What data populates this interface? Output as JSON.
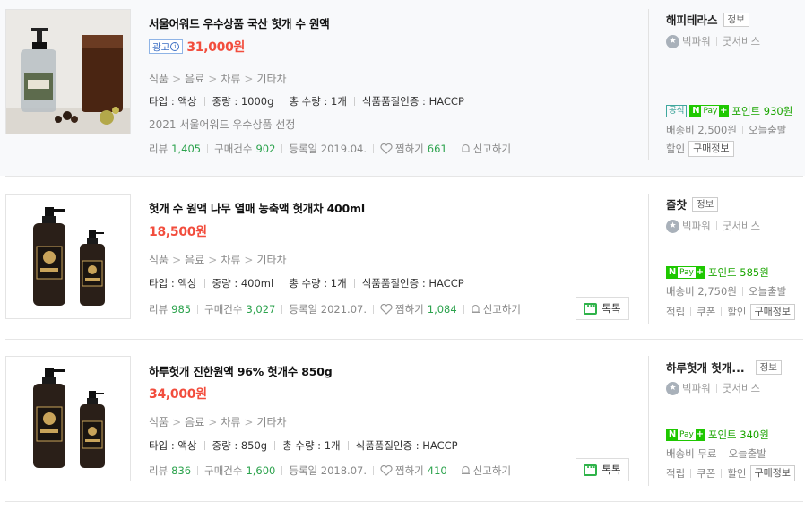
{
  "products": [
    {
      "title": "서울어워드 우수상품 국산 헛개 수 원액",
      "ad": true,
      "ad_label": "광고",
      "price": "31,000원",
      "category": [
        "식품",
        "음료",
        "차류",
        "기타차"
      ],
      "spec": [
        "타입 : 액상",
        "중량 : 1000g",
        "총 수량 : 1개",
        "식품품질인증 : HACCP"
      ],
      "note": "2021 서울어워드 우수상품 선정",
      "review_label": "리뷰",
      "review_count": "1,405",
      "purchase_label": "구매건수",
      "purchase_count": "902",
      "reg_label": "등록일 2019.04.",
      "wish_label": "찜하기",
      "wish_count": "661",
      "report_label": "신고하기",
      "talk_label": "",
      "mall": {
        "name": "해피테라스",
        "info_label": "정보",
        "grade": "빅파워",
        "service": "굿서비스",
        "official_label": "공식",
        "npay_label": "Pay",
        "point": "포인트 930원",
        "shipping": "배송비 2,500원",
        "dispatch": "오늘출발",
        "benefits": [
          "할인"
        ],
        "purchase_info": "구매정보"
      }
    },
    {
      "title": "헛개 수 원액 나무 열매 농축액 헛개차 400ml",
      "ad": false,
      "price": "18,500원",
      "category": [
        "식품",
        "음료",
        "차류",
        "기타차"
      ],
      "spec": [
        "타입 : 액상",
        "중량 : 400ml",
        "총 수량 : 1개",
        "식품품질인증 : HACCP"
      ],
      "note": "",
      "review_label": "리뷰",
      "review_count": "985",
      "purchase_label": "구매건수",
      "purchase_count": "3,027",
      "reg_label": "등록일 2021.07.",
      "wish_label": "찜하기",
      "wish_count": "1,084",
      "report_label": "신고하기",
      "talk_label": "톡톡",
      "mall": {
        "name": "즐찻",
        "info_label": "정보",
        "grade": "빅파워",
        "service": "굿서비스",
        "npay_label": "Pay",
        "point": "포인트 585원",
        "shipping": "배송비 2,750원",
        "dispatch": "오늘출발",
        "benefits": [
          "적립",
          "쿠폰",
          "할인"
        ],
        "purchase_info": "구매정보"
      }
    },
    {
      "title": "하루헛개 진한원액 96% 헛개수 850g",
      "ad": false,
      "price": "34,000원",
      "category": [
        "식품",
        "음료",
        "차류",
        "기타차"
      ],
      "spec": [
        "타입 : 액상",
        "중량 : 850g",
        "총 수량 : 1개",
        "식품품질인증 : HACCP"
      ],
      "note": "",
      "review_label": "리뷰",
      "review_count": "836",
      "purchase_label": "구매건수",
      "purchase_count": "1,600",
      "reg_label": "등록일 2018.07.",
      "wish_label": "찜하기",
      "wish_count": "410",
      "report_label": "신고하기",
      "talk_label": "톡톡",
      "mall": {
        "name": "하루헛개 헛개...",
        "info_label": "정보",
        "grade": "빅파워",
        "service": "굿서비스",
        "npay_label": "Pay",
        "point": "포인트 340원",
        "shipping": "배송비 무료",
        "dispatch": "오늘출발",
        "benefits": [
          "적립",
          "쿠폰",
          "할인"
        ],
        "purchase_info": "구매정보"
      }
    }
  ]
}
